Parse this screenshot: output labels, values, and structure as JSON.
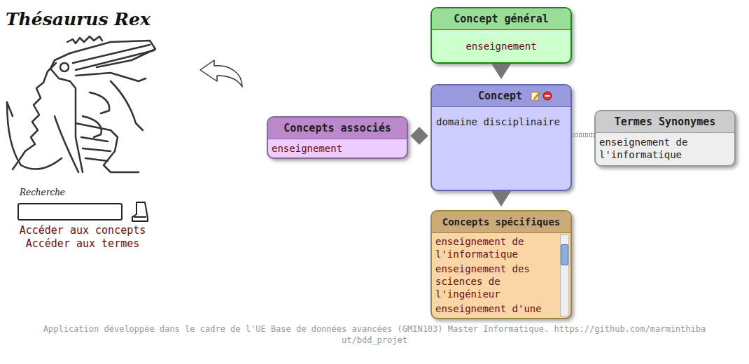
{
  "logo": {
    "title": "Thésaurus Rex"
  },
  "search": {
    "label": "Recherche",
    "value": ""
  },
  "links": [
    "Accéder aux concepts",
    "Accéder aux termes"
  ],
  "general": {
    "title": "Concept général",
    "items": [
      "enseignement"
    ]
  },
  "concept": {
    "title": "Concept",
    "name": "domaine disciplinaire"
  },
  "associated": {
    "title": "Concepts associés",
    "items": [
      "enseignement"
    ]
  },
  "synonyms": {
    "title": "Termes Synonymes",
    "items": [
      "enseignement de l'informatique"
    ]
  },
  "specific": {
    "title": "Concepts spécifiques",
    "items": [
      "enseignement de l'informatique",
      "enseignement des sciences de l'ingénieur",
      "enseignement d'une"
    ]
  },
  "footer": "Application développée dans le cadre de l'UE Base de données avancées (GMIN103) Master Informatique. https://github.com/marminthibaut/bdd_projet"
}
